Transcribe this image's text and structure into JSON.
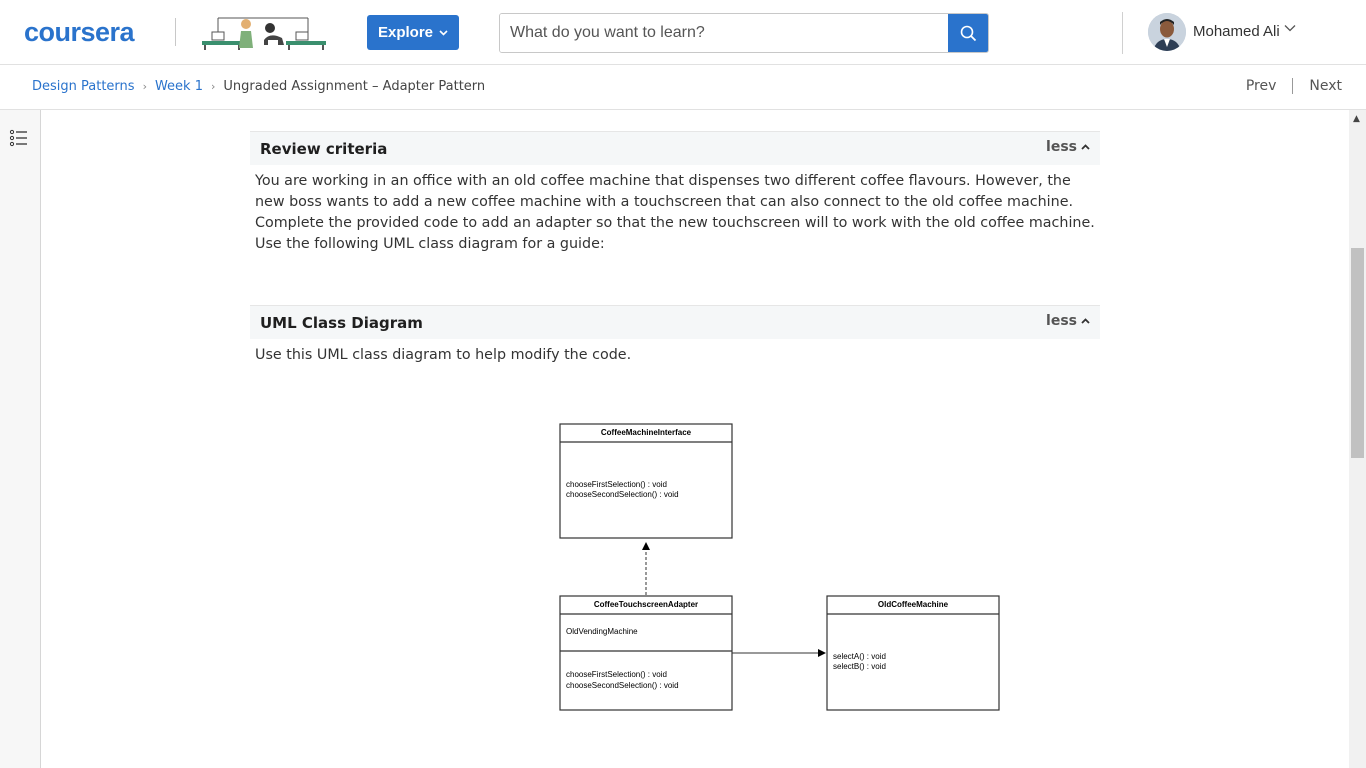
{
  "header": {
    "logo_text": "coursera",
    "explore_label": "Explore",
    "search_placeholder": "What do you want to learn?",
    "user_name": "Mohamed Ali"
  },
  "breadcrumb": {
    "items": [
      "Design Patterns",
      "Week 1",
      "Ungraded Assignment – Adapter Pattern"
    ],
    "prev_label": "Prev",
    "next_label": "Next"
  },
  "sections": {
    "review": {
      "title": "Review criteria",
      "toggle": "less",
      "body": "You are working in an office with an old coffee machine that dispenses two different coffee flavours. However, the new boss wants to add a new coffee machine with a touchscreen that can also connect to the old coffee machine. Complete the provided code to add an adapter so that the new touchscreen will to work with the old coffee machine. Use the following UML class diagram for a guide:"
    },
    "uml": {
      "title": "UML Class Diagram",
      "toggle": "less",
      "body": "Use this UML class diagram to help modify the code."
    }
  },
  "diagram": {
    "interface_name": "CoffeeMachineInterface",
    "interface_method_1": "chooseFirstSelection() : void",
    "interface_method_2": "chooseSecondSelection() : void",
    "adapter_name": "CoffeeTouchscreenAdapter",
    "adapter_attribute": "OldVendingMachine",
    "adapter_method_1": "chooseFirstSelection() : void",
    "adapter_method_2": "chooseSecondSelection() : void",
    "old_name": "OldCoffeeMachine",
    "old_method_1": "selectA() : void",
    "old_method_2": "selectB() : void"
  },
  "colors": {
    "brand_blue": "#2a73cc"
  },
  "icons": [
    "search-icon",
    "chevron-down-icon",
    "table-of-contents-icon",
    "chevron-up-icon",
    "chevron-right-icon"
  ]
}
